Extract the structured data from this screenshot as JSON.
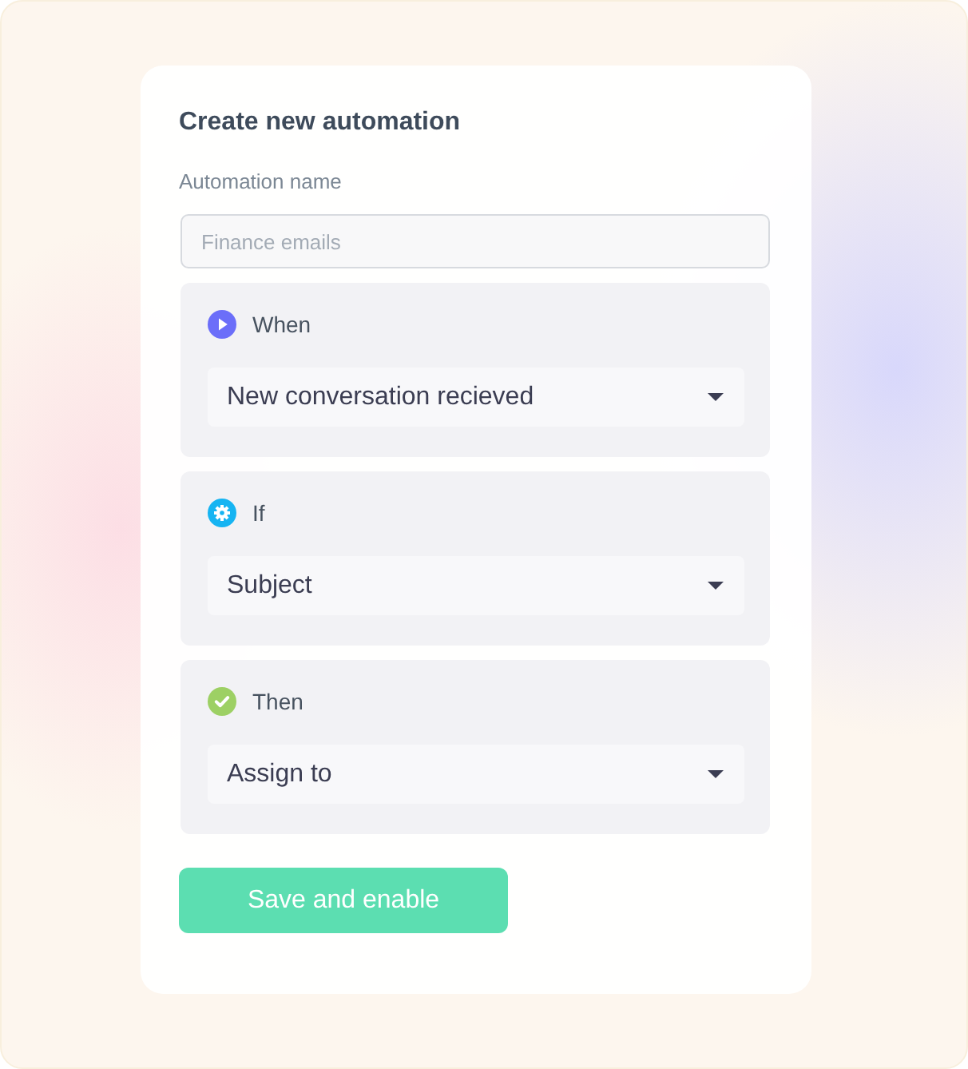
{
  "title": "Create new automation",
  "name_field": {
    "label": "Automation name",
    "placeholder": "Finance emails"
  },
  "steps": [
    {
      "kind": "trigger",
      "label": "When",
      "color": "#6b6ef9",
      "dropdown": {
        "value": "New conversation recieved"
      }
    },
    {
      "kind": "condition",
      "label": "If",
      "color": "#16b4f2",
      "dropdown": {
        "value": "Subject"
      }
    },
    {
      "kind": "action",
      "label": "Then",
      "color": "#9dd064",
      "dropdown": {
        "value": "Assign to"
      }
    }
  ],
  "primary_button": "Save and enable"
}
